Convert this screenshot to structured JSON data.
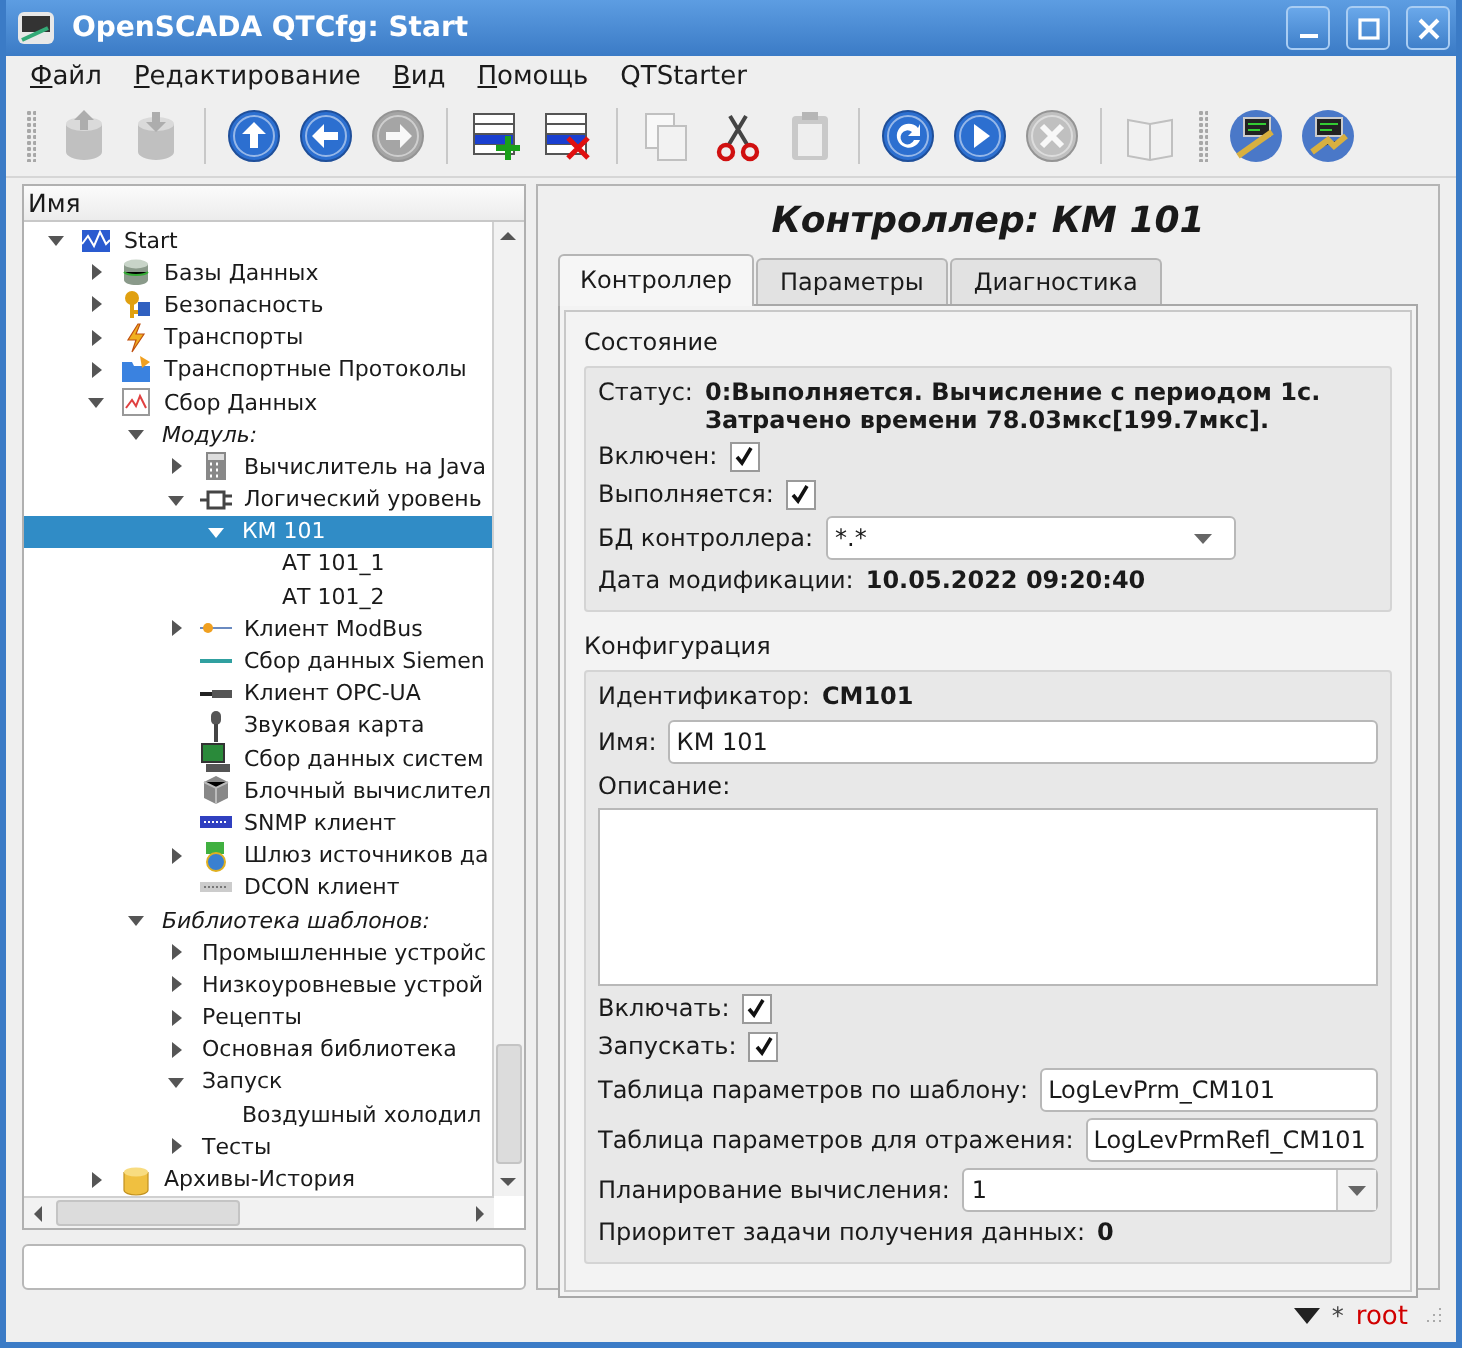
{
  "window": {
    "title": "OpenSCADA QTCfg: Start"
  },
  "menu": [
    {
      "label": "Файл",
      "mnemonic": true
    },
    {
      "label": "Редактирование",
      "mnemonic": true
    },
    {
      "label": "Вид",
      "mnemonic": true
    },
    {
      "label": "Помощь",
      "mnemonic": true
    },
    {
      "label": "QTStarter",
      "mnemonic": false
    }
  ],
  "toolbars": [
    [
      [
        {
          "kind": "db-load",
          "disabled": true
        },
        {
          "kind": "db-save",
          "disabled": true
        }
      ],
      [
        {
          "kind": "up",
          "disabled": false
        },
        {
          "kind": "back",
          "disabled": false
        },
        {
          "kind": "forward",
          "disabled": true
        }
      ],
      [
        {
          "kind": "add",
          "disabled": false
        },
        {
          "kind": "delete",
          "disabled": false
        }
      ],
      [
        {
          "kind": "copy",
          "disabled": true
        },
        {
          "kind": "cut",
          "disabled": false
        },
        {
          "kind": "paste",
          "disabled": true
        }
      ],
      [
        {
          "kind": "refresh",
          "disabled": false
        },
        {
          "kind": "start",
          "disabled": false
        },
        {
          "kind": "stop",
          "disabled": true
        }
      ],
      [
        {
          "kind": "manual",
          "disabled": true
        }
      ]
    ],
    [
      [
        {
          "kind": "app-a",
          "disabled": false
        },
        {
          "kind": "app-b",
          "disabled": false
        }
      ]
    ]
  ],
  "tree": {
    "header": "Имя",
    "items": [
      {
        "label": "Start",
        "kind": "start",
        "expanded": true,
        "selected": false,
        "children": [
          {
            "label": "Базы Данных",
            "kind": "database",
            "expanded": false,
            "selected": false
          },
          {
            "label": "Безопасность",
            "kind": "security",
            "expanded": false,
            "selected": false
          },
          {
            "label": "Транспорты",
            "kind": "lightning",
            "expanded": false,
            "selected": false
          },
          {
            "label": "Транспортные Протоколы",
            "kind": "folder",
            "expanded": false,
            "selected": false
          },
          {
            "label": "Сбор Данных",
            "kind": "chart",
            "expanded": true,
            "selected": false,
            "children": [
              {
                "label": "Модуль:",
                "kind": "group",
                "expanded": true,
                "selected": false,
                "children": [
                  {
                    "label": "Вычислитель на Java",
                    "kind": "calculator",
                    "expanded": false,
                    "selected": false
                  },
                  {
                    "label": "Логический уровень",
                    "kind": "plug",
                    "expanded": true,
                    "selected": false,
                    "children": [
                      {
                        "label": "КМ 101",
                        "expanded": true,
                        "selected": true,
                        "children": [
                          {
                            "label": "АТ 101_1",
                            "selected": false
                          },
                          {
                            "label": "АТ 101_2",
                            "selected": false
                          }
                        ]
                      }
                    ]
                  },
                  {
                    "label": "Клиент ModBus",
                    "kind": "modbus",
                    "expanded": false,
                    "selected": false
                  },
                  {
                    "label": "Сбор данных Siemen",
                    "kind": "siemens",
                    "selected": false
                  },
                  {
                    "label": "Клиент OPC-UA",
                    "kind": "opc",
                    "selected": false
                  },
                  {
                    "label": "Звуковая карта",
                    "kind": "microphone",
                    "selected": false
                  },
                  {
                    "label": "Сбор данных систем",
                    "kind": "monitor",
                    "selected": false
                  },
                  {
                    "label": "Блочный вычислител",
                    "kind": "cube",
                    "selected": false
                  },
                  {
                    "label": "SNMP клиент",
                    "kind": "snmp",
                    "selected": false
                  },
                  {
                    "label": "Шлюз источников да",
                    "kind": "gateway",
                    "expanded": false,
                    "selected": false
                  },
                  {
                    "label": "DCON клиент",
                    "kind": "dcon",
                    "selected": false
                  }
                ]
              },
              {
                "label": "Библиотека шаблонов:",
                "kind": "group",
                "expanded": true,
                "selected": false,
                "children": [
                  {
                    "label": "Промышленные устройс",
                    "expanded": false,
                    "selected": false
                  },
                  {
                    "label": "Низкоуровневые устрой",
                    "expanded": false,
                    "selected": false
                  },
                  {
                    "label": "Рецепты",
                    "expanded": false,
                    "selected": false
                  },
                  {
                    "label": "Основная библиотека",
                    "expanded": false,
                    "selected": false
                  },
                  {
                    "label": "Запуск",
                    "expanded": true,
                    "selected": false,
                    "children": [
                      {
                        "label": "Воздушный холодил",
                        "selected": false
                      }
                    ]
                  },
                  {
                    "label": "Тесты",
                    "expanded": false,
                    "selected": false
                  }
                ]
              }
            ]
          },
          {
            "label": "Архивы-История",
            "kind": "archive",
            "expanded": false,
            "selected": false
          }
        ]
      }
    ]
  },
  "panel": {
    "title": "Контроллер: КМ 101",
    "tabs": [
      {
        "label": "Контроллер",
        "selected": true
      },
      {
        "label": "Параметры",
        "selected": false
      },
      {
        "label": "Диагностика",
        "selected": false
      }
    ],
    "sections": [
      {
        "title": "Состояние",
        "fields": [
          {
            "kind": "info",
            "label": "Статус:",
            "value": "0:Выполняется. Вычисление с периодом 1с.\nЗатрачено времени 78.03мкс[199.7мкс]."
          },
          {
            "kind": "check",
            "label": "Включен:",
            "checked": true
          },
          {
            "kind": "check",
            "label": "Выполняется:",
            "checked": true
          },
          {
            "kind": "combo",
            "label": "БД контроллера:",
            "value": "*.*"
          },
          {
            "kind": "info",
            "label": "Дата модификации:",
            "value": "10.05.2022 09:20:40"
          }
        ]
      },
      {
        "title": "Конфигурация",
        "fields": [
          {
            "kind": "info",
            "label": "Идентификатор:",
            "value": "CM101"
          },
          {
            "kind": "input",
            "label": "Имя:",
            "value": "КМ 101"
          },
          {
            "kind": "textarea",
            "label": "Описание:"
          },
          {
            "kind": "check",
            "label": "Включать:",
            "checked": true
          },
          {
            "kind": "check",
            "label": "Запускать:",
            "checked": true
          },
          {
            "kind": "input",
            "label": "Таблица параметров по шаблону:",
            "value": "LogLevPrm_CM101"
          },
          {
            "kind": "input",
            "label": "Таблица параметров для отражения:",
            "value": "LogLevPrmRefl_CM101"
          },
          {
            "kind": "select",
            "label": "Планирование вычисления:",
            "value": "1"
          },
          {
            "kind": "info",
            "label": "Приоритет задачи получения данных:",
            "value": "0"
          }
        ]
      }
    ]
  },
  "status_bar": {
    "marker": "*",
    "user": "root"
  }
}
